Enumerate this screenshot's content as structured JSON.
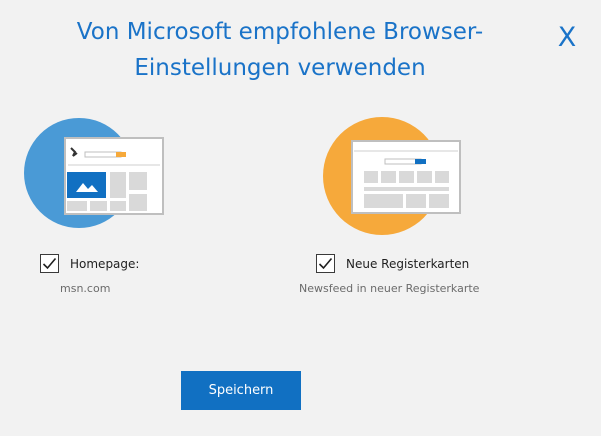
{
  "dialog": {
    "title_line1": "Von Microsoft empfohlene Browser-",
    "title_line2": "Einstellungen verwenden",
    "close_label": "X"
  },
  "options": {
    "homepage": {
      "label": "Homepage:",
      "description": "msn.com",
      "checked": true,
      "circle_color": "#4a9ad6"
    },
    "newtab": {
      "label": "Neue Registerkarten",
      "description": "Newsfeed in neuer Registerkarte",
      "checked": true,
      "circle_color": "#f6a93b"
    }
  },
  "actions": {
    "save_label": "Speichern"
  },
  "colors": {
    "accent": "#1170c2",
    "title": "#1a73c8",
    "background": "#f2f2f2"
  }
}
